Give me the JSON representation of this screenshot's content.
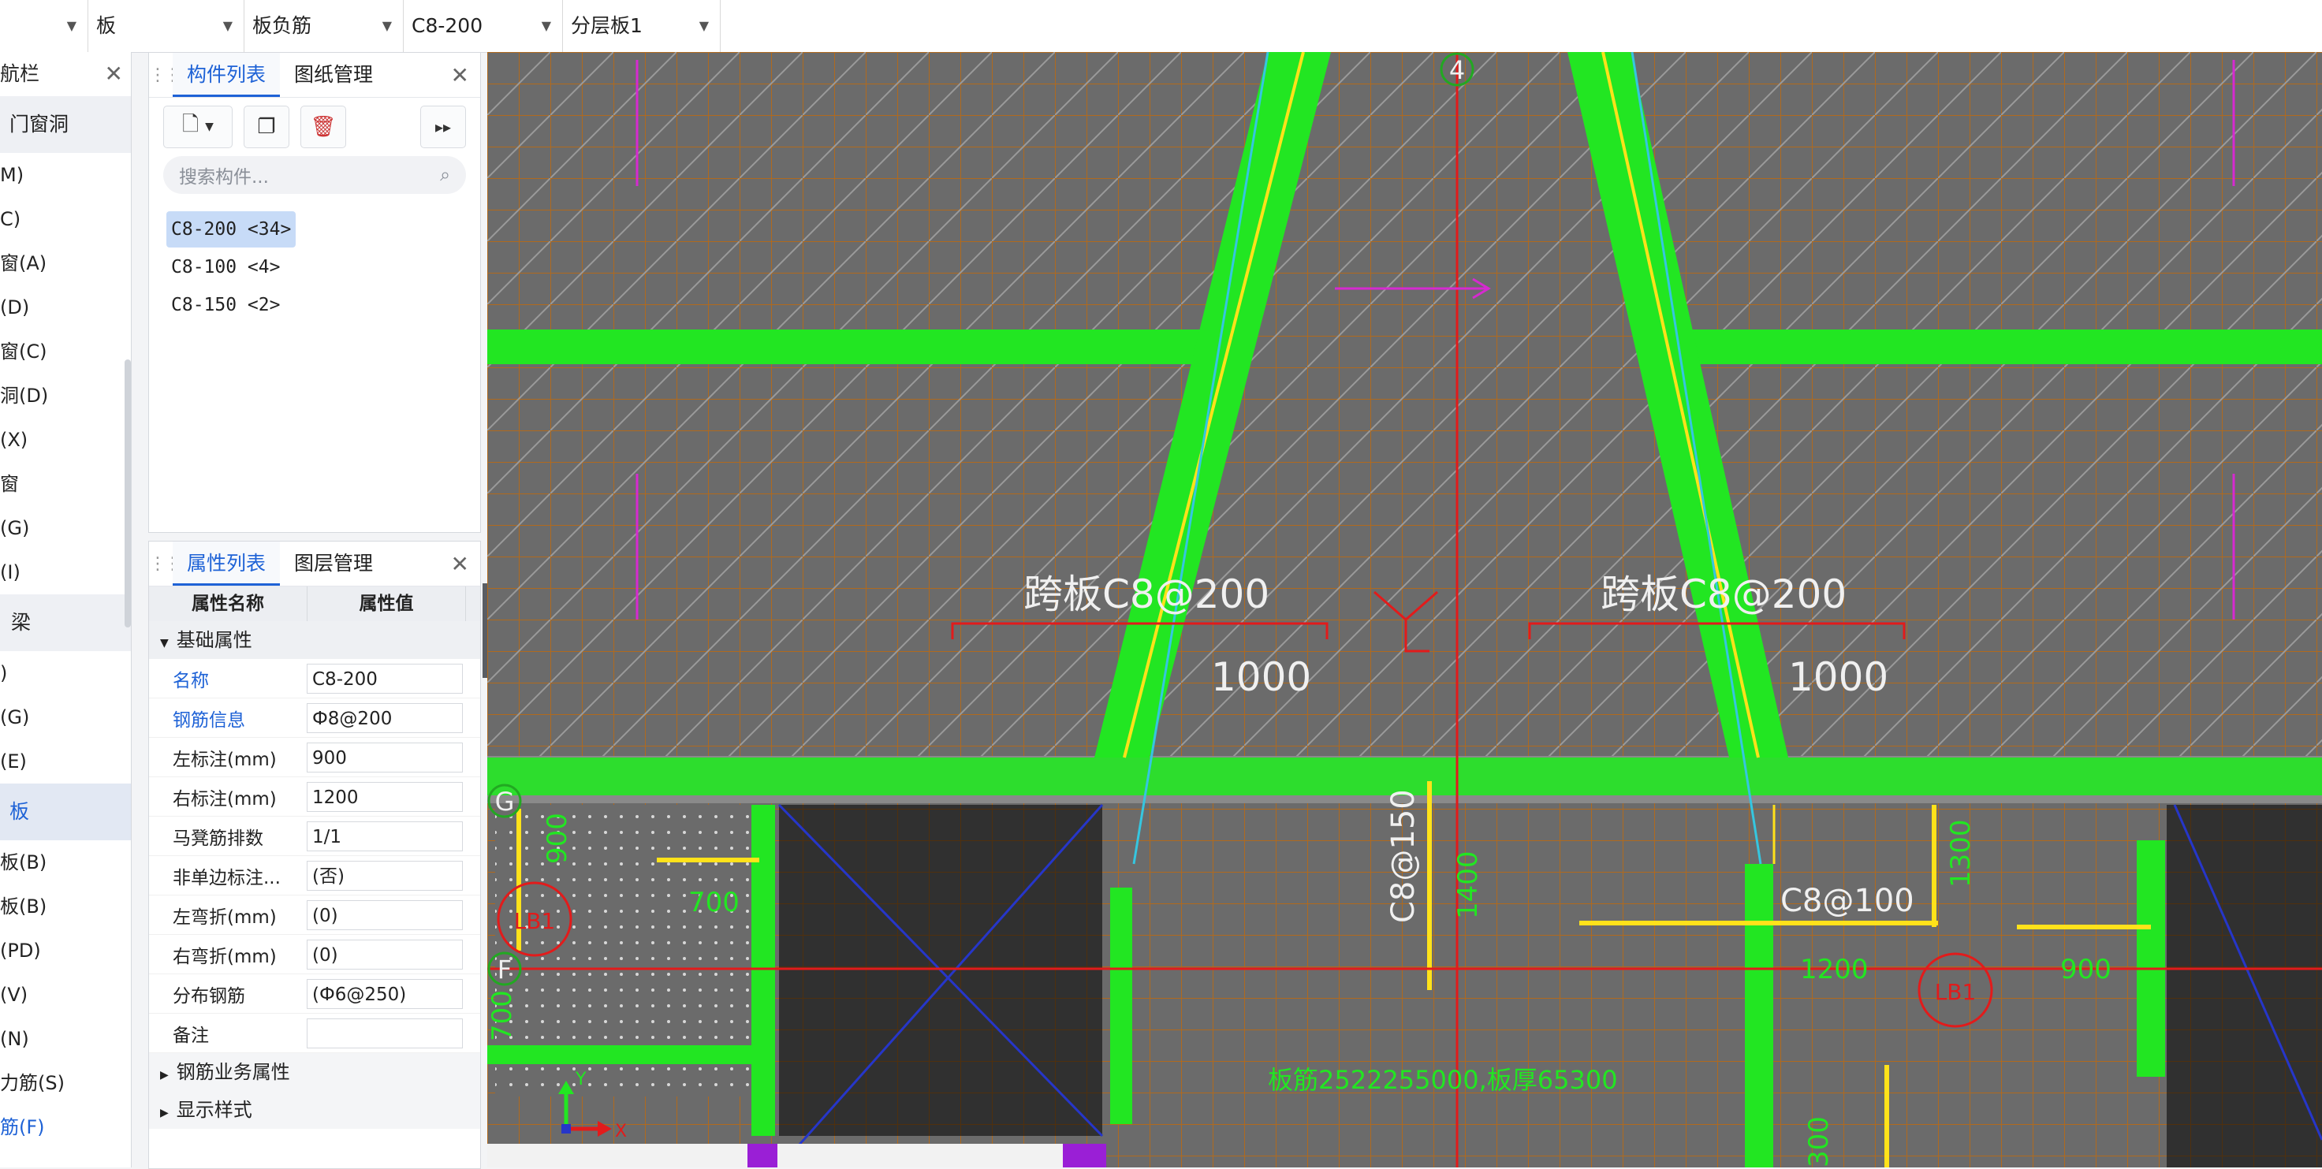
{
  "topbar": {
    "dropdowns": [
      "",
      "板",
      "板负筋",
      "C8-200",
      "分层板1"
    ]
  },
  "nav": {
    "title": "航栏",
    "groups": {
      "door": "门窗洞",
      "beam": "梁",
      "slab": "板"
    },
    "items_a": [
      "M)",
      "C)",
      "窗(A)",
      "(D)",
      "窗(C)",
      "洞(D)",
      "(X)",
      "窗",
      "(G)",
      "(I)"
    ],
    "items_b": [
      ")",
      "(G)",
      "(E)"
    ],
    "items_c": [
      "板(B)",
      "板(B)",
      "(PD)",
      "(V)",
      "(N)",
      "力筋(S)",
      "筋(F)"
    ]
  },
  "component_panel": {
    "tabs": [
      "构件列表",
      "图纸管理"
    ],
    "search_placeholder": "搜索构件...",
    "items": [
      "C8-200 <34>",
      "C8-100 <4>",
      "C8-150 <2>"
    ]
  },
  "property_panel": {
    "tabs": [
      "属性列表",
      "图层管理"
    ],
    "col_name": "属性名称",
    "col_value": "属性值",
    "section_basic": "基础属性",
    "rows": [
      {
        "label": "名称",
        "value": "C8-200"
      },
      {
        "label": "钢筋信息",
        "value": "Ф8@200"
      },
      {
        "label": "左标注(mm)",
        "value": "900"
      },
      {
        "label": "右标注(mm)",
        "value": "1200"
      },
      {
        "label": "马凳筋排数",
        "value": "1/1"
      },
      {
        "label": "非单边标注...",
        "value": "(否)"
      },
      {
        "label": "左弯折(mm)",
        "value": "(0)"
      },
      {
        "label": "右弯折(mm)",
        "value": "(0)"
      },
      {
        "label": "分布钢筋",
        "value": "(Ф6@250)"
      },
      {
        "label": "备注",
        "value": ""
      }
    ],
    "section_rebar": "钢筋业务属性",
    "section_display": "显示样式"
  },
  "canvas": {
    "axis_4": "4",
    "axis_g": "G",
    "axis_f": "F",
    "label_left": "跨板C8@200",
    "label_right": "跨板C8@200",
    "dim_left": "1000",
    "dim_right": "1000",
    "c8_150": "C8@150",
    "c8_100": "C8@100",
    "d900": "900",
    "d700": "700",
    "d1400": "1400",
    "d1300": "1300",
    "d1200": "1200",
    "d900b": "900",
    "d700b": "700",
    "lb1": "LB1",
    "lb1b": "LB1",
    "bottom_text": "板筋2522255000,板厚65300",
    "y_label": "Y",
    "x_label": "X",
    "d300": "300",
    "colors": {
      "rebar": "#22e622",
      "grid": "#b06a1e",
      "axis": "#e21b1b",
      "magenta": "#d62ad0"
    }
  }
}
